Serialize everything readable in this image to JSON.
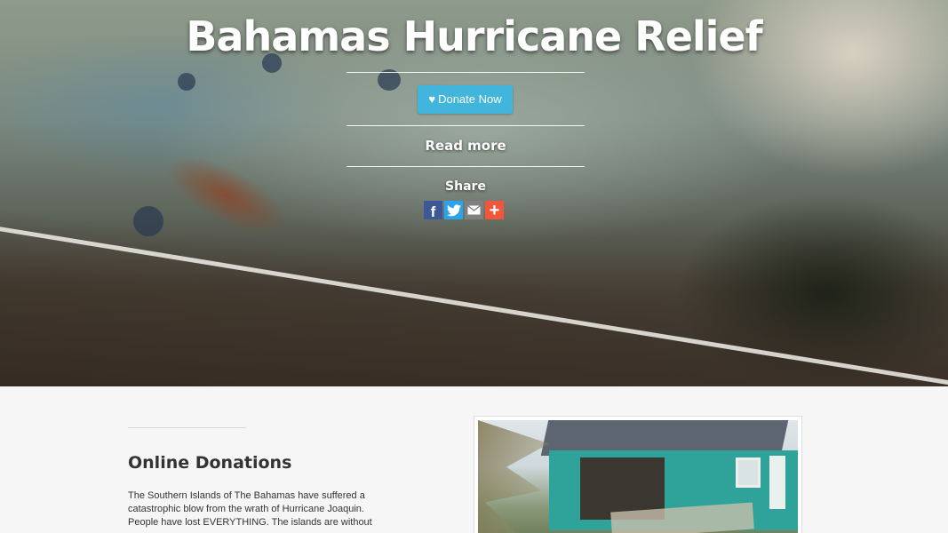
{
  "hero": {
    "title": "Bahamas Hurricane Relief",
    "donate_label": "Donate Now",
    "read_more_label": "Read more",
    "share_label": "Share",
    "share_icons": [
      "facebook-icon",
      "twitter-icon",
      "email-icon",
      "addthis-plus-icon"
    ]
  },
  "colors": {
    "donate_button": "#41b5dc",
    "facebook": "#3b5998",
    "twitter": "#2aa3ef",
    "email": "#808080",
    "plus": "#f0573a"
  },
  "section": {
    "title": "Online Donations",
    "text": "The Southern Islands of The Bahamas have suffered a catastrophic blow from the wrath of Hurricane Joaquin. People have lost EVERYTHING. The islands are without"
  }
}
